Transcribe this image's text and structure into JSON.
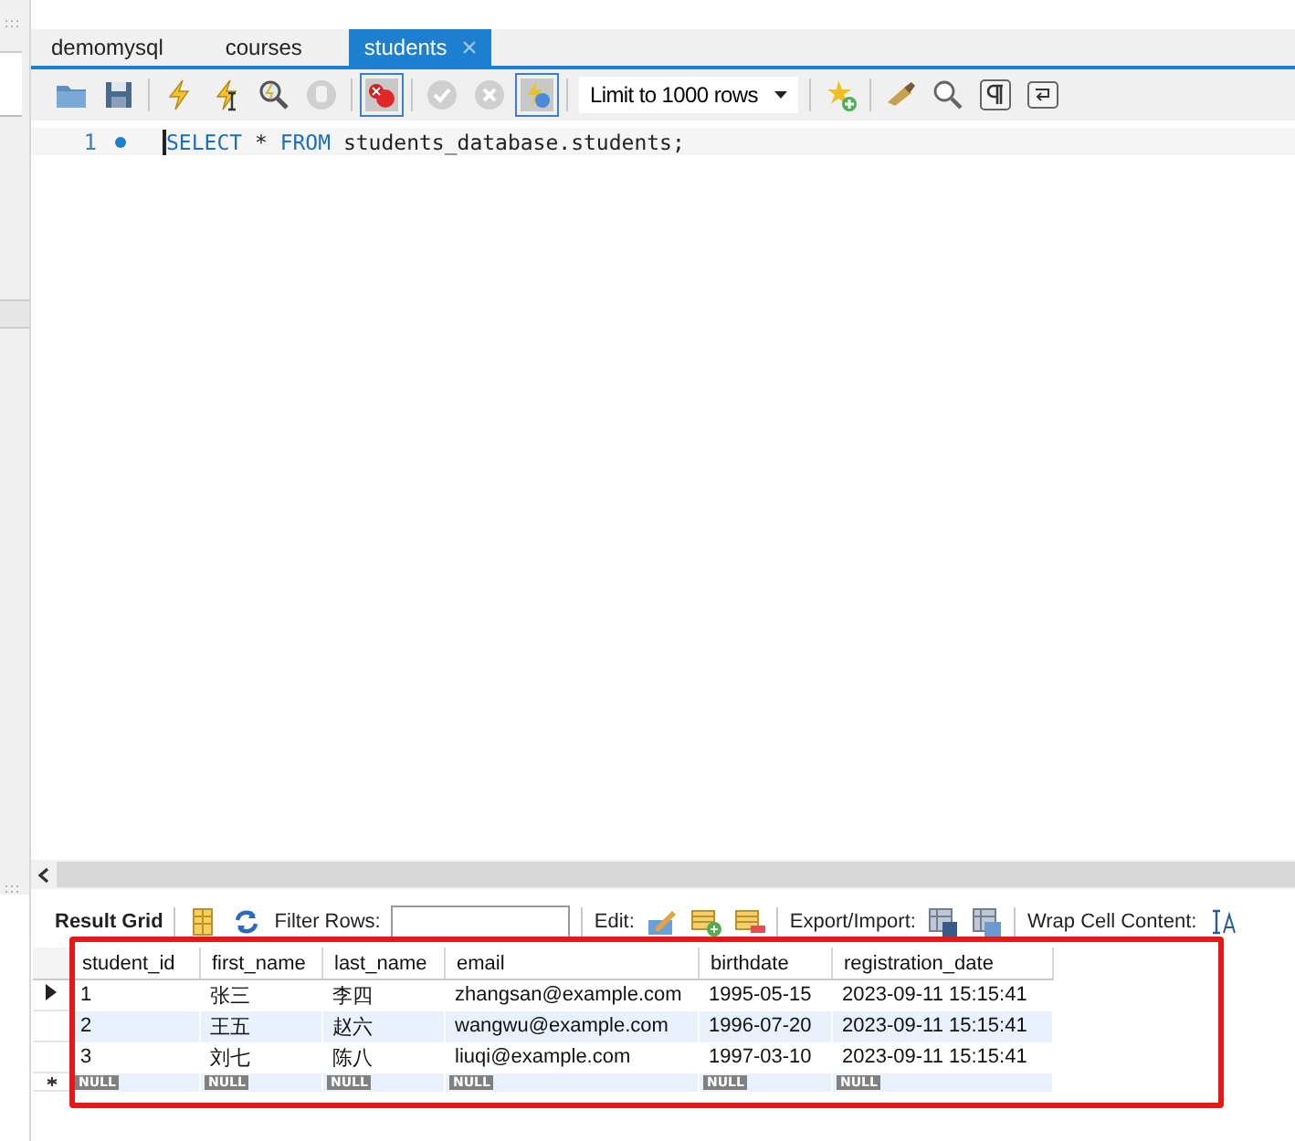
{
  "tabs": [
    {
      "label": "demomysql",
      "selected": false,
      "closable": false
    },
    {
      "label": "courses",
      "selected": false,
      "closable": false
    },
    {
      "label": "students",
      "selected": true,
      "closable": true
    }
  ],
  "toolbar": {
    "limit": "Limit to 1000 rows"
  },
  "editor": {
    "lines": [
      {
        "number": "1",
        "tokens": [
          {
            "kind": "keyword",
            "text": "SELECT"
          },
          {
            "kind": "plain",
            "text": " * "
          },
          {
            "kind": "keyword",
            "text": "FROM"
          },
          {
            "kind": "plain",
            "text": " students_database.students;"
          }
        ]
      }
    ]
  },
  "result_toolbar": {
    "result_grid": "Result Grid",
    "filter_label": "Filter Rows:",
    "edit_label": "Edit:",
    "export_label": "Export/Import:",
    "wrap_label": "Wrap Cell Content:"
  },
  "table": {
    "columns": [
      "student_id",
      "first_name",
      "last_name",
      "email",
      "birthdate",
      "registration_date"
    ],
    "rows": [
      {
        "selected": true,
        "cells": [
          "1",
          "张三",
          "李四",
          "zhangsan@example.com",
          "1995-05-15",
          "2023-09-11 15:15:41"
        ]
      },
      {
        "selected": false,
        "cells": [
          "2",
          "王五",
          "赵六",
          "wangwu@example.com",
          "1996-07-20",
          "2023-09-11 15:15:41"
        ]
      },
      {
        "selected": false,
        "cells": [
          "3",
          "刘七",
          "陈八",
          "liuqi@example.com",
          "1997-03-10",
          "2023-09-11 15:15:41"
        ]
      }
    ],
    "new_row": [
      "NULL",
      "NULL",
      "NULL",
      "NULL",
      "NULL",
      "NULL"
    ]
  }
}
